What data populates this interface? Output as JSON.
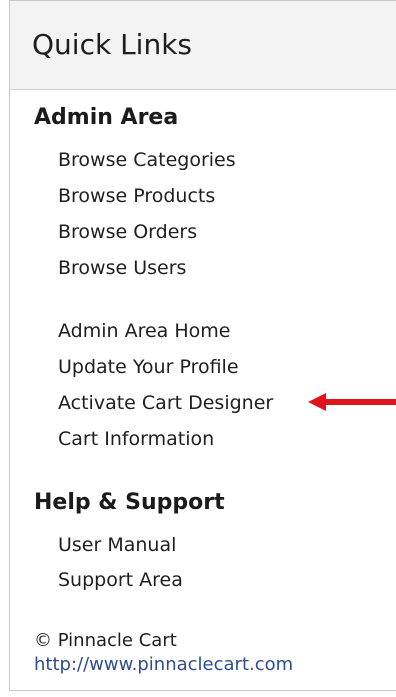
{
  "panel": {
    "title": "Quick Links"
  },
  "sections": {
    "admin": {
      "title": "Admin Area",
      "links": [
        "Browse Categories",
        "Browse Products",
        "Browse Orders",
        "Browse Users",
        "Admin Area Home",
        "Update Your Profile",
        "Activate Cart Designer",
        "Cart Information"
      ]
    },
    "help": {
      "title": "Help & Support",
      "links": [
        "User Manual",
        "Support Area"
      ]
    }
  },
  "footer": {
    "copyright": "© Pinnacle Cart",
    "url": "http://www.pinnaclecart.com"
  },
  "annotation": {
    "arrow_color": "#e0141c",
    "arrow_icon": "left-arrow-icon"
  }
}
